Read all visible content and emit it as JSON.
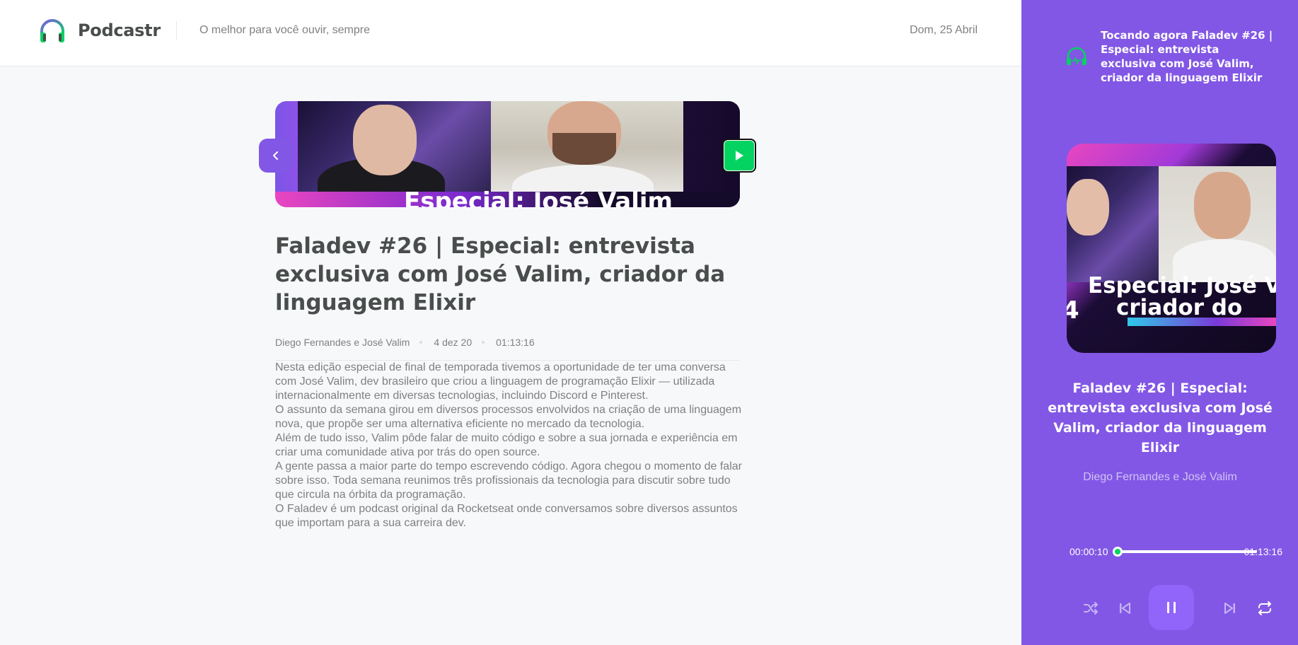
{
  "header": {
    "logo_text": "Podcastr",
    "tagline": "O melhor para você ouvir, sempre",
    "date": "Dom, 25 Abril"
  },
  "episode": {
    "thumbnail_caption": "Especial: José Valim",
    "title": "Faladev #26 | Especial: entrevista exclusiva com José Valim, criador da linguagem Elixir",
    "members": "Diego Fernandes e José Valim",
    "published_at": "4 dez 20",
    "duration": "01:13:16",
    "description": [
      "Nesta edição especial de final de temporada tivemos a oportunidade de ter uma conversa com José Valim, dev brasileiro que criou a linguagem de programação Elixir — utilizada internacionalmente em diversas tecnologias, incluindo Discord e Pinterest.",
      "O assunto da semana girou em diversos processos envolvidos na criação de uma linguagem nova, que propõe ser uma alternativa eficiente no mercado da tecnologia.",
      "Além de tudo isso, Valim pôde falar de muito código e sobre a sua jornada e experiência em criar uma comunidade ativa por trás do open source.",
      "A gente passa a maior parte do tempo escrevendo código. Agora chegou o momento de falar sobre isso. Toda semana reunimos três profissionais da tecnologia para discutir sobre tudo que circula na órbita da programação.",
      "O Faladev é um podcast original da Rocketseat onde conversamos sobre diversos assuntos que importam para a sua carreira dev."
    ]
  },
  "player": {
    "now_playing_label": "Tocando agora Faladev #26 | Especial: entrevista exclusiva com José Valim, criador da linguagem Elixir",
    "cover_text_line1": "Especial: José V",
    "cover_text_line2": "criador do",
    "cover_number": "4",
    "title": "Faladev #26 | Especial: entrevista exclusiva com José Valim, criador da linguagem Elixir",
    "members": "Diego Fernandes e José Valim",
    "current_time": "00:00:10",
    "duration": "01:13:16",
    "progress": 0.0023,
    "controls": [
      "shuffle-icon",
      "previous-icon",
      "pause-icon",
      "next-icon",
      "repeat-icon"
    ]
  },
  "colors": {
    "accent": "#8257e5",
    "accent_light": "#9164fa",
    "green": "#04d361",
    "text_heading": "#494d4b",
    "text_body": "#808080",
    "background": "#f7f8fa"
  }
}
